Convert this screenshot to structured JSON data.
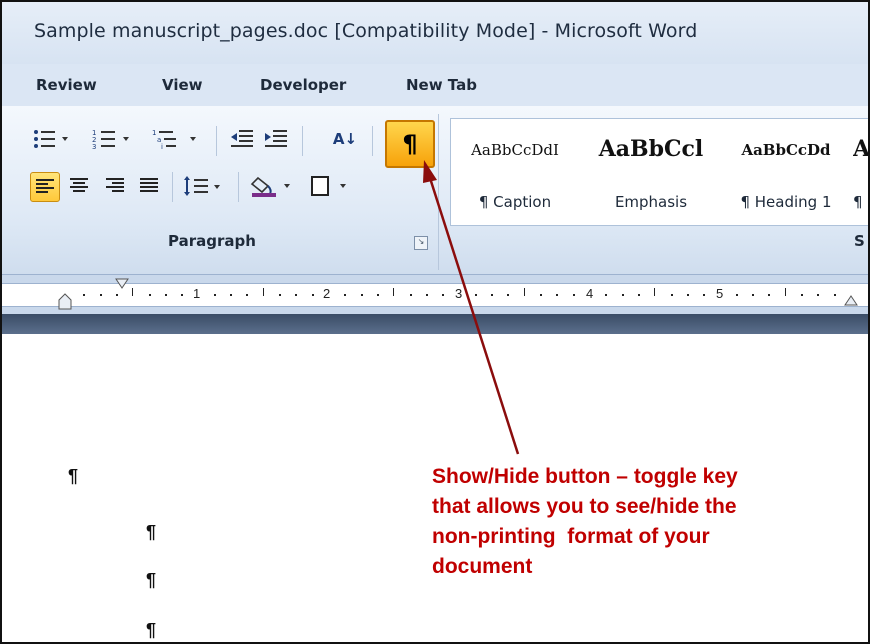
{
  "window": {
    "title": "Sample manuscript_pages.doc [Compatibility Mode] - Microsoft Word"
  },
  "tabs": [
    "Review",
    "View",
    "Developer",
    "New Tab"
  ],
  "ribbon": {
    "paragraph_group": {
      "label": "Paragraph",
      "show_hide_glyph": "¶",
      "sort_glyph": "A↓",
      "icons": [
        "bullets-icon",
        "numbering-icon",
        "multilevel-list-icon",
        "decrease-indent-icon",
        "increase-indent-icon",
        "sort-icon",
        "show-hide-icon",
        "align-left-icon",
        "center-icon",
        "align-right-icon",
        "justify-icon",
        "line-spacing-icon",
        "shading-icon",
        "borders-icon"
      ]
    },
    "styles_group": {
      "label": "S",
      "items": [
        {
          "sample": "AaBbCcDdI",
          "name": "¶ Caption"
        },
        {
          "sample": "AaBbCcl",
          "name": "Emphasis"
        },
        {
          "sample": "AaBbCcDd",
          "name": "¶ Heading 1"
        },
        {
          "sample": "A",
          "name": "¶"
        }
      ]
    }
  },
  "ruler": {
    "numbers": [
      "1",
      "2",
      "3",
      "4",
      "5"
    ]
  },
  "document": {
    "pilcrows": [
      "¶",
      "¶",
      "¶",
      "¶"
    ]
  },
  "annotation": {
    "lines": [
      "Show/Hide button – toggle key",
      "that allows you to see/hide the",
      "non-printing  format of your",
      "document"
    ],
    "color": "#c00000"
  },
  "colors": {
    "active_button": "#ffc93a",
    "ribbon_bg": "#dde8f5",
    "annotation_arrow": "#8b0d0d"
  }
}
